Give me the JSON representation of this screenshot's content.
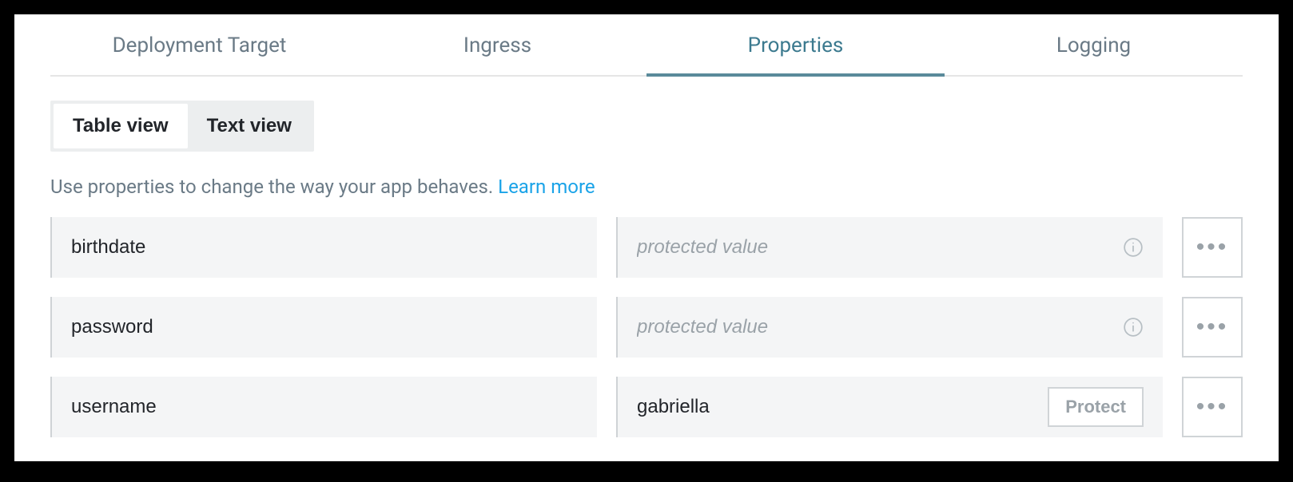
{
  "tabs": {
    "items": [
      {
        "label": "Deployment Target",
        "active": false
      },
      {
        "label": "Ingress",
        "active": false
      },
      {
        "label": "Properties",
        "active": true
      },
      {
        "label": "Logging",
        "active": false
      }
    ]
  },
  "view_toggle": {
    "table": "Table view",
    "text": "Text view",
    "active": "table"
  },
  "description": {
    "text": "Use properties to change the way your app behaves. ",
    "learn_more": "Learn more"
  },
  "properties": {
    "protected_placeholder": "protected value",
    "protect_button": "Protect",
    "rows": [
      {
        "key": "birthdate",
        "value": "",
        "protected": true
      },
      {
        "key": "password",
        "value": "",
        "protected": true
      },
      {
        "key": "username",
        "value": "gabriella",
        "protected": false
      }
    ]
  }
}
